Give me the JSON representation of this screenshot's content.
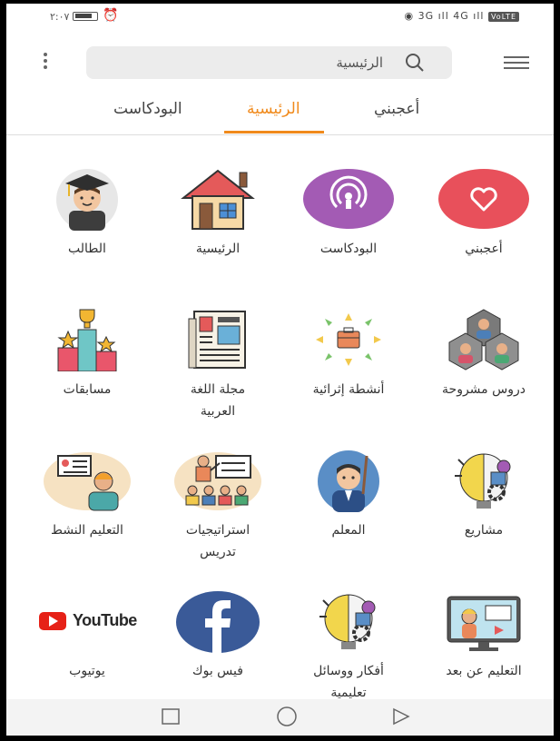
{
  "status_bar": {
    "time": "٢:٠٧",
    "signal": "3G ıll 4G ıll",
    "volte": "VoLTE"
  },
  "search": {
    "label": "الرئيسية"
  },
  "tabs": [
    {
      "label": "البودكاست",
      "active": false
    },
    {
      "label": "الرئيسية",
      "active": true
    },
    {
      "label": "أعجبني",
      "active": false
    }
  ],
  "grid": [
    {
      "label": "الطالب",
      "icon": "graduate-student-icon"
    },
    {
      "label": "الرئيسية",
      "icon": "home-house-icon"
    },
    {
      "label": "البودكاست",
      "icon": "podcast-icon"
    },
    {
      "label": "أعجبني",
      "icon": "heart-icon"
    },
    {
      "label": "مسابقات",
      "icon": "podium-trophy-icon"
    },
    {
      "label": "مجلة اللغة\nالعربية",
      "icon": "newspaper-icon"
    },
    {
      "label": "أنشطة إثرائية",
      "icon": "briefcase-activity-icon"
    },
    {
      "label": "دروس مشروحة",
      "icon": "people-lessons-icon"
    },
    {
      "label": "التعليم النشط",
      "icon": "active-learning-icon"
    },
    {
      "label": "استراتيجيات\nتدريس",
      "icon": "classroom-strategy-icon"
    },
    {
      "label": "المعلم",
      "icon": "teacher-icon"
    },
    {
      "label": "مشاريع",
      "icon": "projects-bulb-gear-icon"
    },
    {
      "label": "يوتيوب",
      "icon": "youtube-logo-icon"
    },
    {
      "label": "فيس بوك",
      "icon": "facebook-logo-icon"
    },
    {
      "label": "أفكار ووسائل\nتعليمية",
      "icon": "ideas-bulb-gear-icon"
    },
    {
      "label": "التعليم عن بعد",
      "icon": "distance-learning-icon"
    }
  ],
  "youtube_wordmark": "YouTube",
  "colors": {
    "accent": "#f08a1c",
    "heart": "#e8505b",
    "podcast": "#a35bb4",
    "facebook": "#3a5a98",
    "youtube": "#e62117"
  }
}
